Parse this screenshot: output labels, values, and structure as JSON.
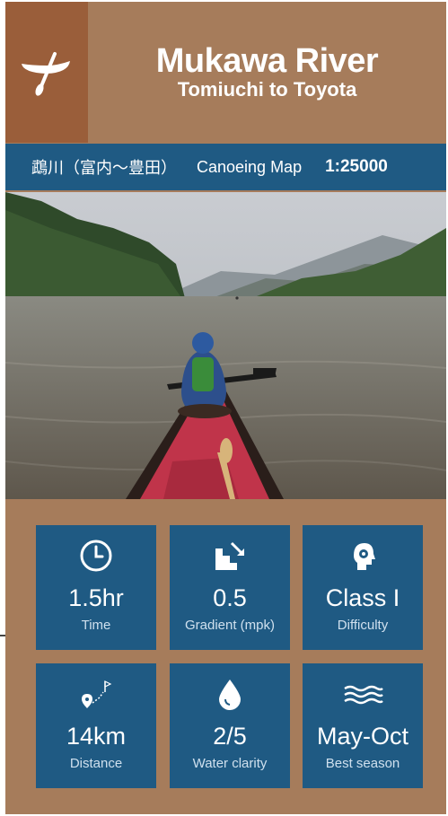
{
  "header": {
    "title": "Mukawa River",
    "subtitle": "Tomiuchi to Toyota",
    "logo_icon": "canoe-paddle-icon"
  },
  "band": {
    "japanese_name": "鵡川（富内〜豊田）",
    "map_type": "Canoeing Map",
    "scale": "1:25000"
  },
  "photo": {
    "subject": "paddler-in-red-canoe-on-river"
  },
  "stats": [
    {
      "icon": "clock-icon",
      "value": "1.5hr",
      "label": "Time"
    },
    {
      "icon": "stairs-descent-icon",
      "value": "0.5",
      "label": "Gradient (mpk)"
    },
    {
      "icon": "head-gear-icon",
      "value": "Class I",
      "label": "Difficulty"
    },
    {
      "icon": "route-pin-icon",
      "value": "14km",
      "label": "Distance"
    },
    {
      "icon": "water-drop-icon",
      "value": "2/5",
      "label": "Water clarity"
    },
    {
      "icon": "waves-icon",
      "value": "May-Oct",
      "label": "Best season"
    }
  ],
  "colors": {
    "card_brown": "#a67c5b",
    "logo_brown": "#9a5e3a",
    "navy": "#1f5a83"
  }
}
